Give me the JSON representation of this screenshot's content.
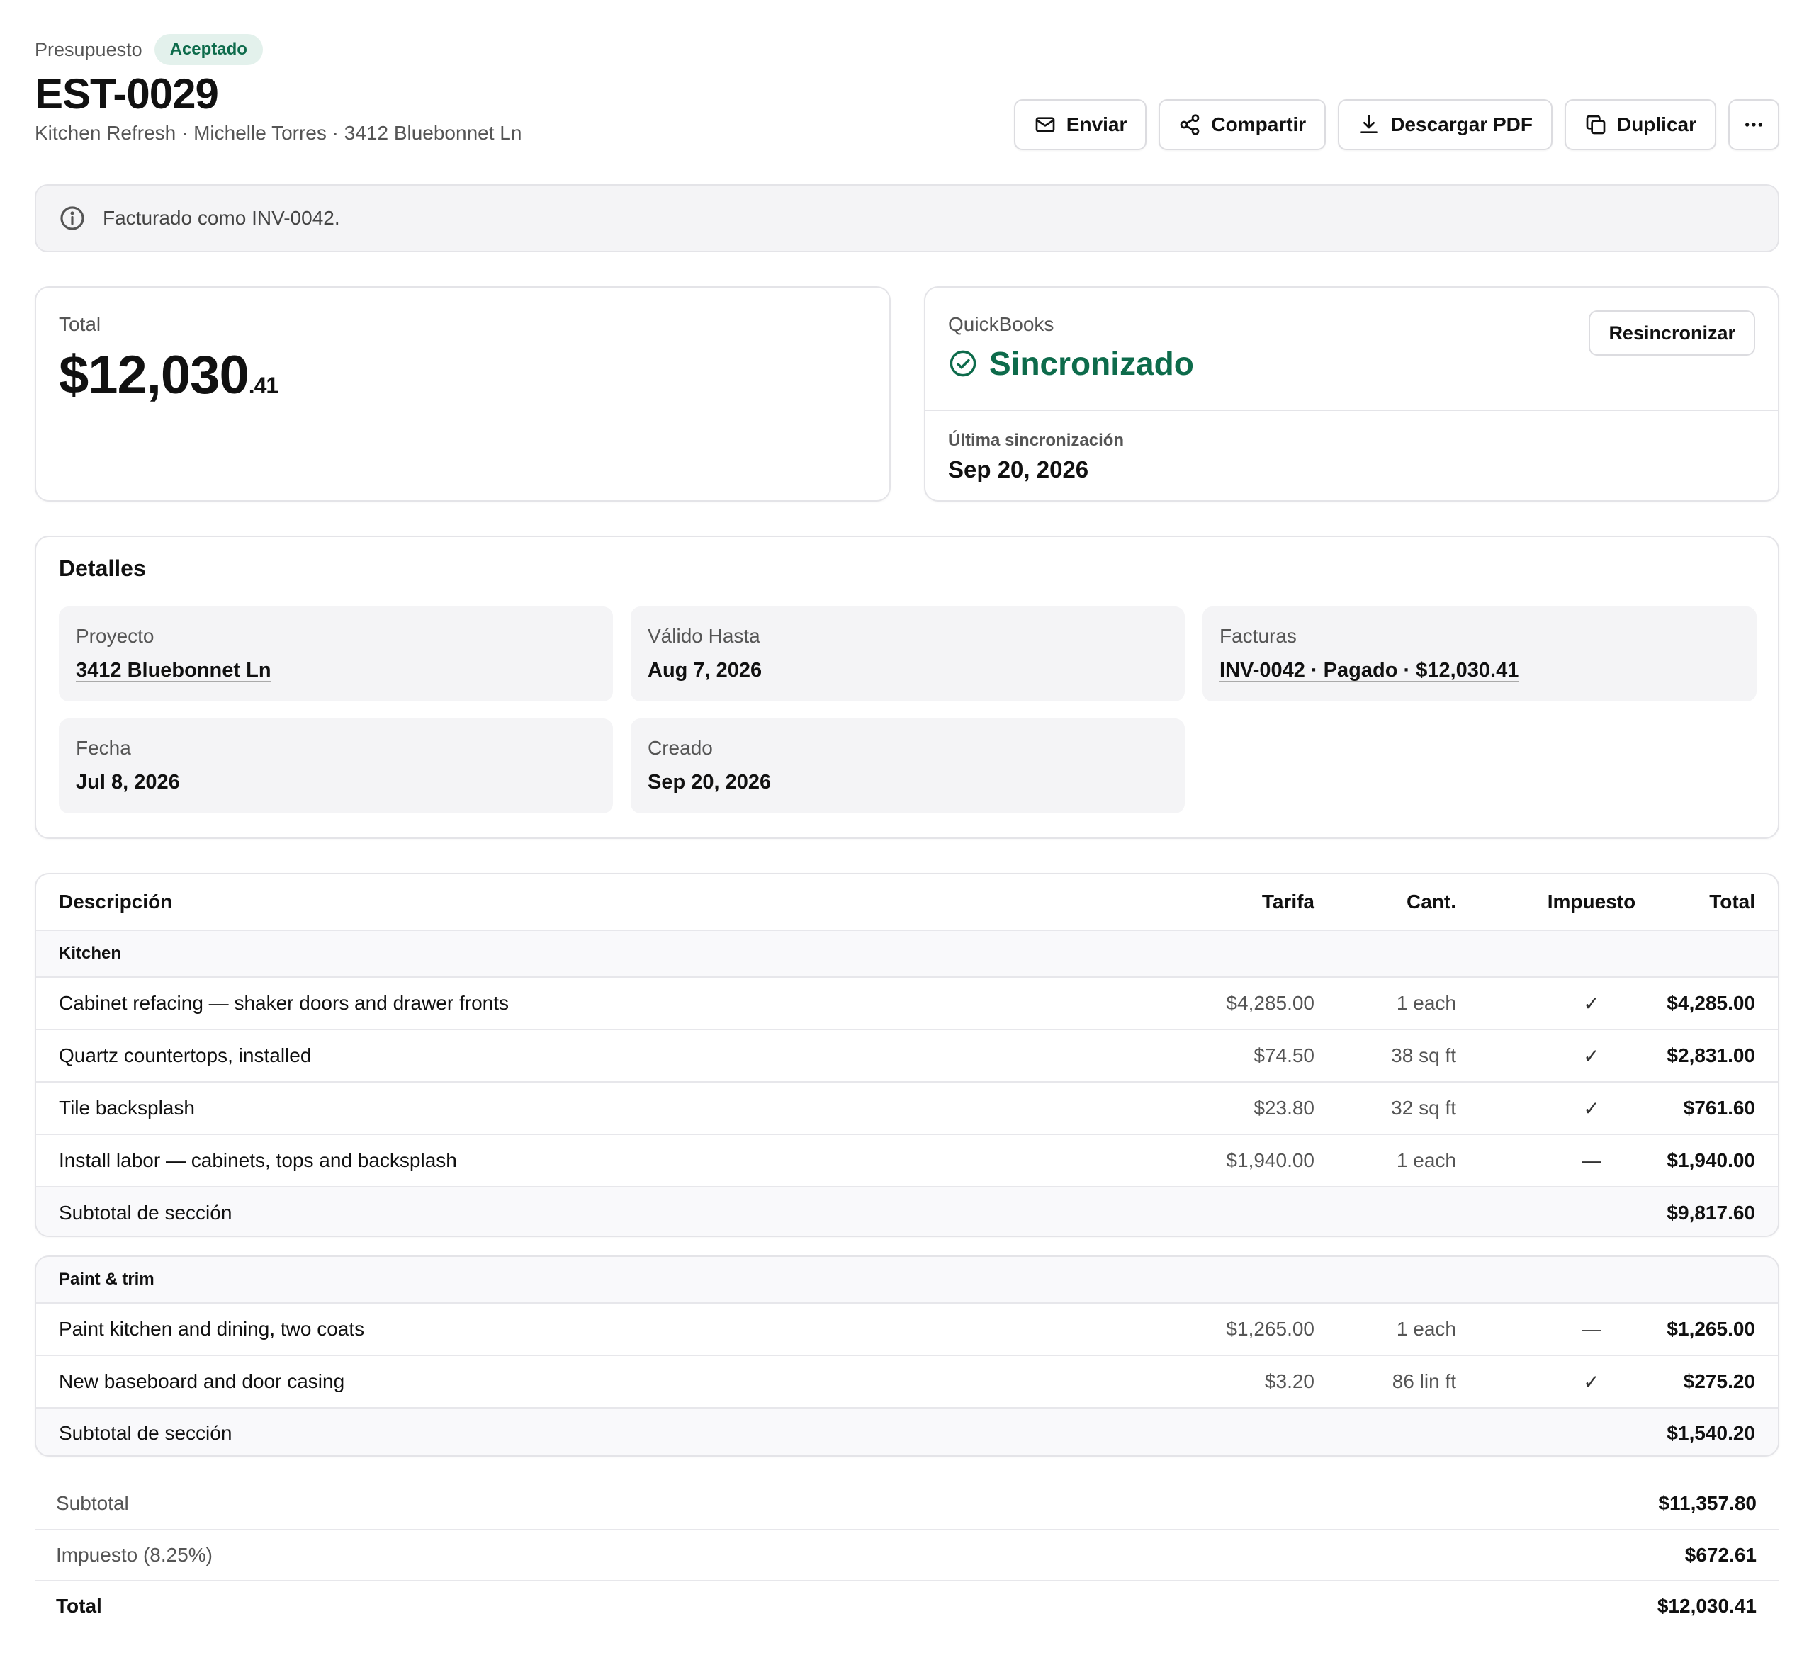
{
  "header": {
    "eyebrow": "Presupuesto",
    "status_badge": "Aceptado",
    "estimate_number": "EST-0029",
    "subtitle": "Kitchen Refresh · Michelle Torres · 3412 Bluebonnet Ln",
    "actions": {
      "send": "Enviar",
      "share": "Compartir",
      "download_pdf": "Descargar PDF",
      "duplicate": "Duplicar",
      "more": "more-horizontal-icon"
    }
  },
  "banner": {
    "icon": "info-icon",
    "text": "Facturado como INV-0042."
  },
  "total_card": {
    "label": "Total",
    "amount_main": "$12,030",
    "amount_cents": ".41"
  },
  "quickbooks": {
    "label": "QuickBooks",
    "status": "Sincronizado",
    "status_color": "#0d6b4b",
    "resync": "Resincronizar",
    "last_sync_label": "Última sincronización",
    "last_sync_value": "Sep 20, 2026"
  },
  "details": {
    "title": "Detalles",
    "project_label": "Proyecto",
    "project_value": "3412 Bluebonnet Ln",
    "valid_until_label": "Válido Hasta",
    "valid_until_value": "Aug 7, 2026",
    "invoices_label": "Facturas",
    "invoices_value": "INV-0042 · Pagado · $12,030.41",
    "date_label": "Fecha",
    "date_value": "Jul 8, 2026",
    "created_label": "Creado",
    "created_value": "Sep 20, 2026"
  },
  "table": {
    "headers": {
      "description": "Descripción",
      "rate": "Tarifa",
      "qty": "Cant.",
      "tax": "Impuesto",
      "total": "Total"
    },
    "sections": [
      {
        "name": "Kitchen",
        "items": [
          {
            "description": "Cabinet refacing — shaker doors and drawer fronts",
            "rate": "$4,285.00",
            "qty": "1 each",
            "tax": "✓",
            "total": "$4,285.00"
          },
          {
            "description": "Quartz countertops, installed",
            "rate": "$74.50",
            "qty": "38 sq ft",
            "tax": "✓",
            "total": "$2,831.00"
          },
          {
            "description": "Tile backsplash",
            "rate": "$23.80",
            "qty": "32 sq ft",
            "tax": "✓",
            "total": "$761.60"
          },
          {
            "description": "Install labor — cabinets, tops and backsplash",
            "rate": "$1,940.00",
            "qty": "1 each",
            "tax": "—",
            "total": "$1,940.00"
          }
        ],
        "subtotal_label": "Subtotal de sección",
        "subtotal": "$9,817.60"
      },
      {
        "name": "Paint & trim",
        "items": [
          {
            "description": "Paint kitchen and dining, two coats",
            "rate": "$1,265.00",
            "qty": "1 each",
            "tax": "—",
            "total": "$1,265.00"
          },
          {
            "description": "New baseboard and door casing",
            "rate": "$3.20",
            "qty": "86 lin ft",
            "tax": "✓",
            "total": "$275.20"
          }
        ],
        "subtotal_label": "Subtotal de sección",
        "subtotal": "$1,540.20"
      }
    ]
  },
  "summary": {
    "subtotal_label": "Subtotal",
    "subtotal": "$11,357.80",
    "tax_label": "Impuesto (8.25%)",
    "tax": "$672.61",
    "total_label": "Total",
    "total": "$12,030.41"
  }
}
